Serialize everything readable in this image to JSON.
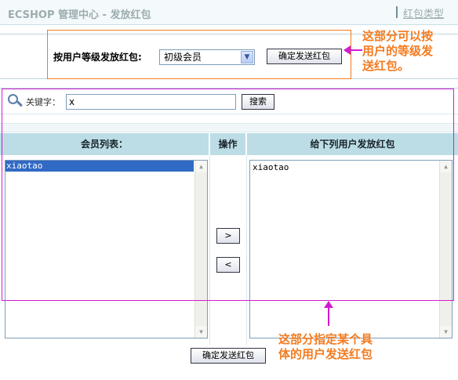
{
  "header": {
    "title": "ECSHOP 管理中心 - 发放红包",
    "link_label": "红包类型"
  },
  "rank_section": {
    "label": "按用户等级发放红包:",
    "select_value": "初级会员",
    "submit_label": "确定发送红包"
  },
  "annotations": {
    "top": [
      "这部分可以按",
      "用户的等级发",
      "送红包。"
    ],
    "bottom": [
      "这部分指定某个具",
      "体的用户发送红包"
    ]
  },
  "search": {
    "label": "关键字：",
    "value": "x",
    "button_label": "搜索"
  },
  "table": {
    "headers": [
      "会员列表：",
      "操作",
      "给下列用户发放红包"
    ],
    "left_items": [
      "xiaotao"
    ],
    "right_items": [
      "xiaotao"
    ],
    "add_label": ">",
    "remove_label": "<"
  },
  "bottom_submit_label": "确定发送红包",
  "colors": {
    "orange": "#f47b20",
    "magenta": "#d11cd1",
    "header_bg": "#bcdde6",
    "selection": "#316ac5"
  }
}
